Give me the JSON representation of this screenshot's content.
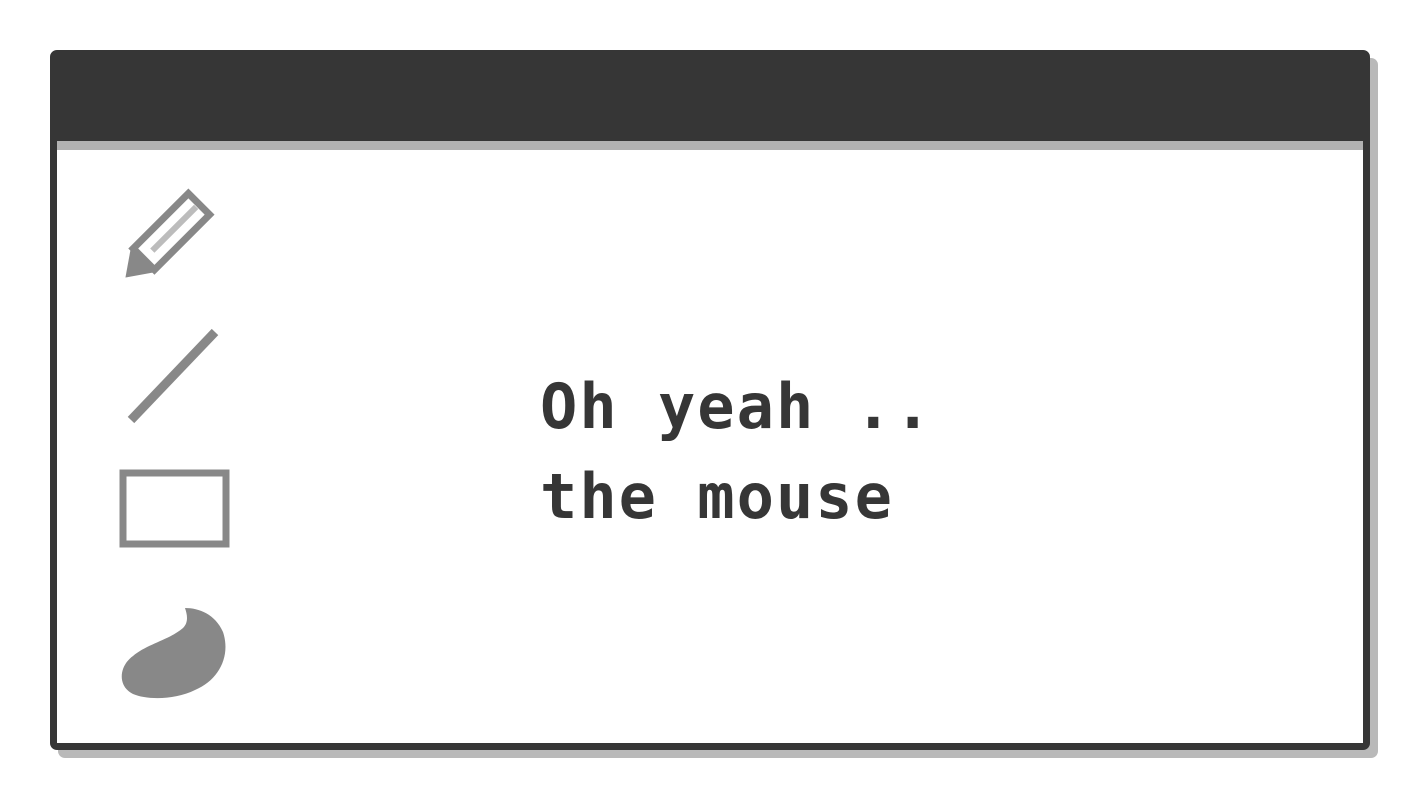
{
  "window": {
    "title": ""
  },
  "toolbar": {
    "tools": [
      {
        "icon": "pencil-icon"
      },
      {
        "icon": "line-icon"
      },
      {
        "icon": "rectangle-icon"
      },
      {
        "icon": "blob-fill-icon"
      }
    ]
  },
  "canvas": {
    "lines": [
      "Oh yeah ..",
      "the mouse"
    ]
  },
  "colors": {
    "frame": "#363636",
    "titlebar_divider": "#b2b2b2",
    "shadow": "#b9b9b9",
    "tool_gray": "#888888",
    "background": "#ffffff"
  }
}
